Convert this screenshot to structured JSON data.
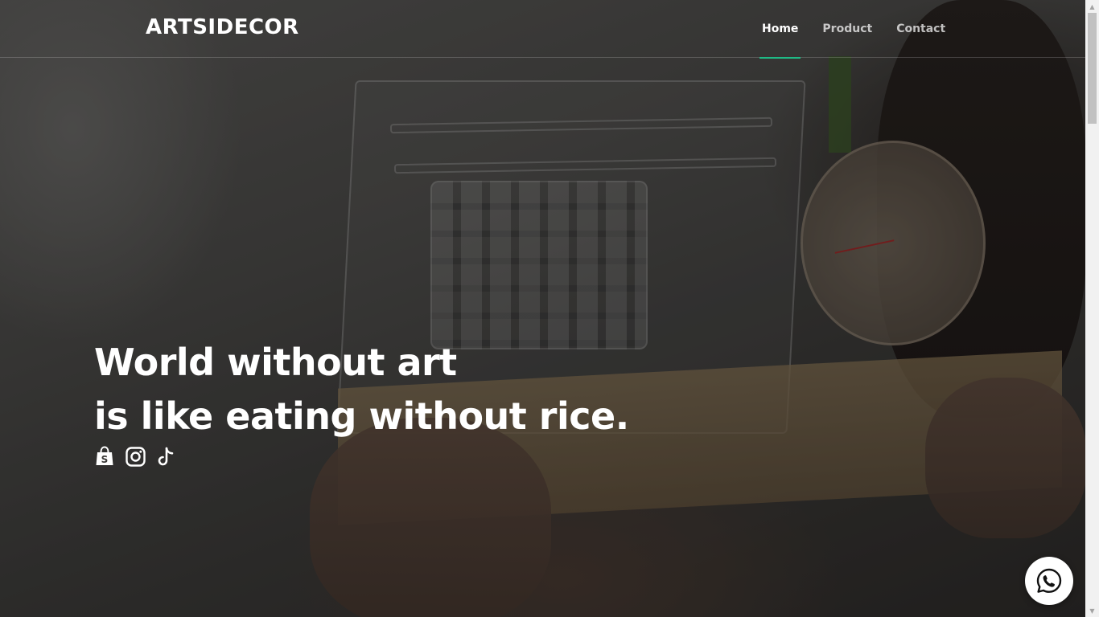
{
  "header": {
    "brand": "ARTSIDECOR",
    "nav": [
      {
        "label": "Home",
        "active": true
      },
      {
        "label": "Product",
        "active": false
      },
      {
        "label": "Contact",
        "active": false
      }
    ],
    "accent_color": "#1fb985"
  },
  "hero": {
    "line1": "World without art",
    "line2": "is like eating without rice.",
    "socials": [
      {
        "icon": "shopee-bag-icon"
      },
      {
        "icon": "instagram-icon"
      },
      {
        "icon": "tiktok-icon"
      }
    ]
  },
  "floating": {
    "icon": "whatsapp-icon"
  }
}
